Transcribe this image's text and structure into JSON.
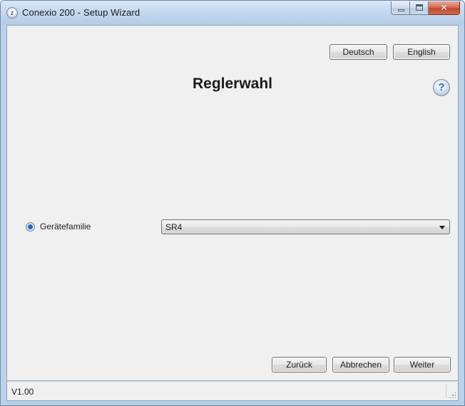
{
  "window": {
    "title": "Conexio 200 - Setup Wizard",
    "app_icon_glyph": "z",
    "close_glyph": "✕"
  },
  "language": {
    "german_label": "Deutsch",
    "english_label": "English"
  },
  "page": {
    "title": "Reglerwahl",
    "help_glyph": "?"
  },
  "form": {
    "radio_label": "Gerätefamilie",
    "radio_checked": true,
    "device_family_selected": "SR4"
  },
  "footer": {
    "back_label": "Zurück",
    "cancel_label": "Abbrechen",
    "next_label": "Weiter"
  },
  "status": {
    "version": "V1.00"
  },
  "icons": {
    "app": "app-logo-icon",
    "help": "help-icon",
    "dropdown": "chevron-down-icon",
    "minimize": "minimize-icon",
    "maximize": "maximize-icon",
    "close": "close-icon"
  },
  "colors": {
    "frame": "#b6cde7",
    "client_bg": "#f0f0f0",
    "close_button": "#c3452b",
    "help_accent": "#2f6ea8",
    "radio_dot": "#2c62b3"
  }
}
